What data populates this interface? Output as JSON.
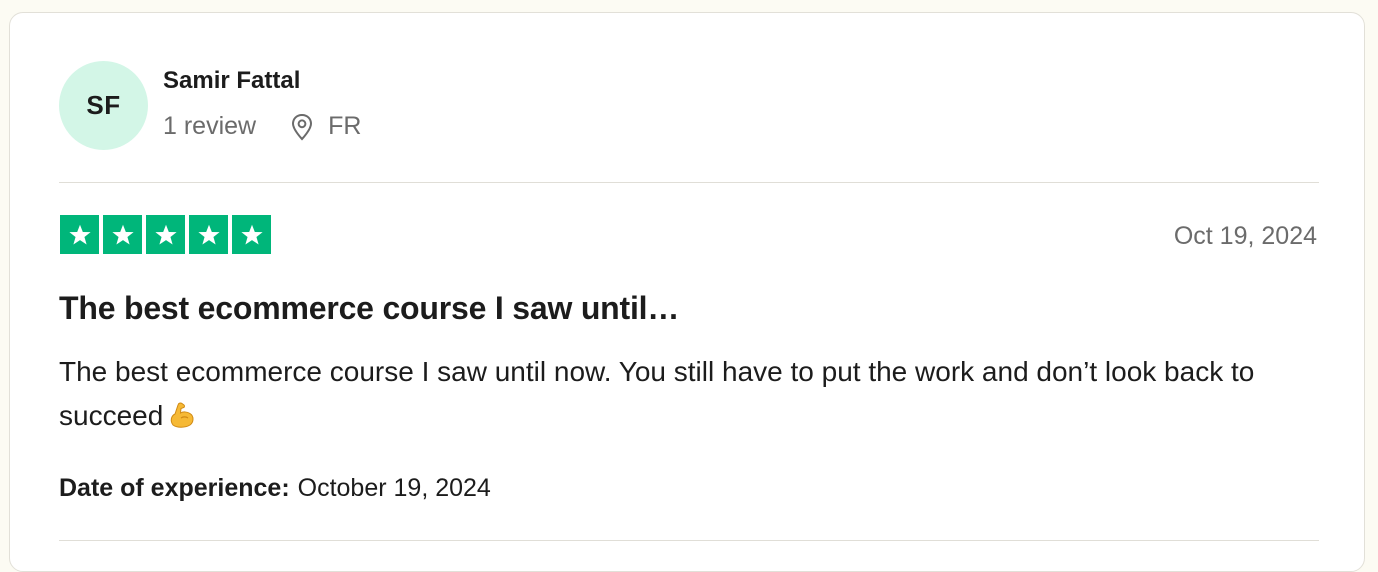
{
  "reviewer": {
    "initials": "SF",
    "name": "Samir Fattal",
    "review_count": "1 review",
    "country": "FR",
    "avatar_color": "#d3f6e7"
  },
  "rating": {
    "stars": 5,
    "max_stars": 5,
    "star_color": "#00b67a",
    "icon": "star-icon"
  },
  "review": {
    "date": "Oct 19, 2024",
    "title": "The best ecommerce course I saw until…",
    "body": "The best ecommerce course I saw until now. You still have to put the work and don’t look back to succeed",
    "body_emoji": "flexed-biceps-emoji"
  },
  "experience": {
    "label": "Date of experience:",
    "value": "October 19, 2024"
  },
  "icons": {
    "location": "location-pin-icon"
  }
}
